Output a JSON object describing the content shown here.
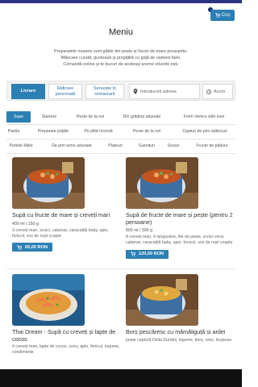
{
  "header": {
    "cart_label": "Coș"
  },
  "page": {
    "title": "Meniu",
    "intro_lines": [
      "Preparatele noastre sunt gătite din pește și fructe de mare proaspete.",
      "Mâncare curată, gustoasă și pregătită cu grijă de oameni faini.",
      "Comandă online și te bucuri de aceleași arome oriunde ești."
    ]
  },
  "order": {
    "modes": [
      {
        "label": "Livrare",
        "active": true
      },
      {
        "label": "Ridicare personală",
        "active": false
      },
      {
        "label": "Servește în restaurant",
        "active": false
      }
    ],
    "address_placeholder": "Introduceți adresa",
    "time_value": "Acum"
  },
  "categories": [
    [
      "Supe",
      "Startere",
      "Peste de la noi",
      "Din grădina adunate",
      "From Venice with love"
    ],
    [
      "Paella",
      "Preparate prăjite",
      "Pe plită încinsă",
      "Peste de la noi",
      "Capturi de prin adâncuri"
    ],
    [
      "Portele Mării",
      "De prin lume adunate",
      "Platouri",
      "Garnituri",
      "Sosuri",
      "Fructe de pădure"
    ]
  ],
  "products": [
    {
      "name": "Supă cu fructe de mare și creveți mari",
      "qty": "400 ml / 150 g",
      "desc": "3 creveți mari, scoici, calamar, caracatiță baby, apio, fenicul, sos de roșii ccapte",
      "price": "65,00 RON"
    },
    {
      "name": "Supă de fructe de mare și pește (pentru 2 persoane)",
      "qty": "800 ml / 300 g",
      "desc": "8 creveți mari, 4 langustine, file de pește, scoici verzi, calamar, caracatiță baby, apio, fenicul, sos de roșii coapte",
      "price": "120,00 RON"
    },
    {
      "name": "Thai Dream - Supă cu creveți și lapte de cocos",
      "qty": "",
      "desc": "4 creveți mari, lapte de cocos, curry, apio, fenicul, legume, condimente",
      "price": ""
    },
    {
      "name": "Borș pescăresc cu mămăliguță și ardei",
      "qty": "",
      "desc": "pește captură Delta Dunării, legume, borș, orez, leuștean",
      "price": ""
    }
  ],
  "colors": {
    "brand": "#2b7fb3",
    "top_band": "#2b3383"
  }
}
